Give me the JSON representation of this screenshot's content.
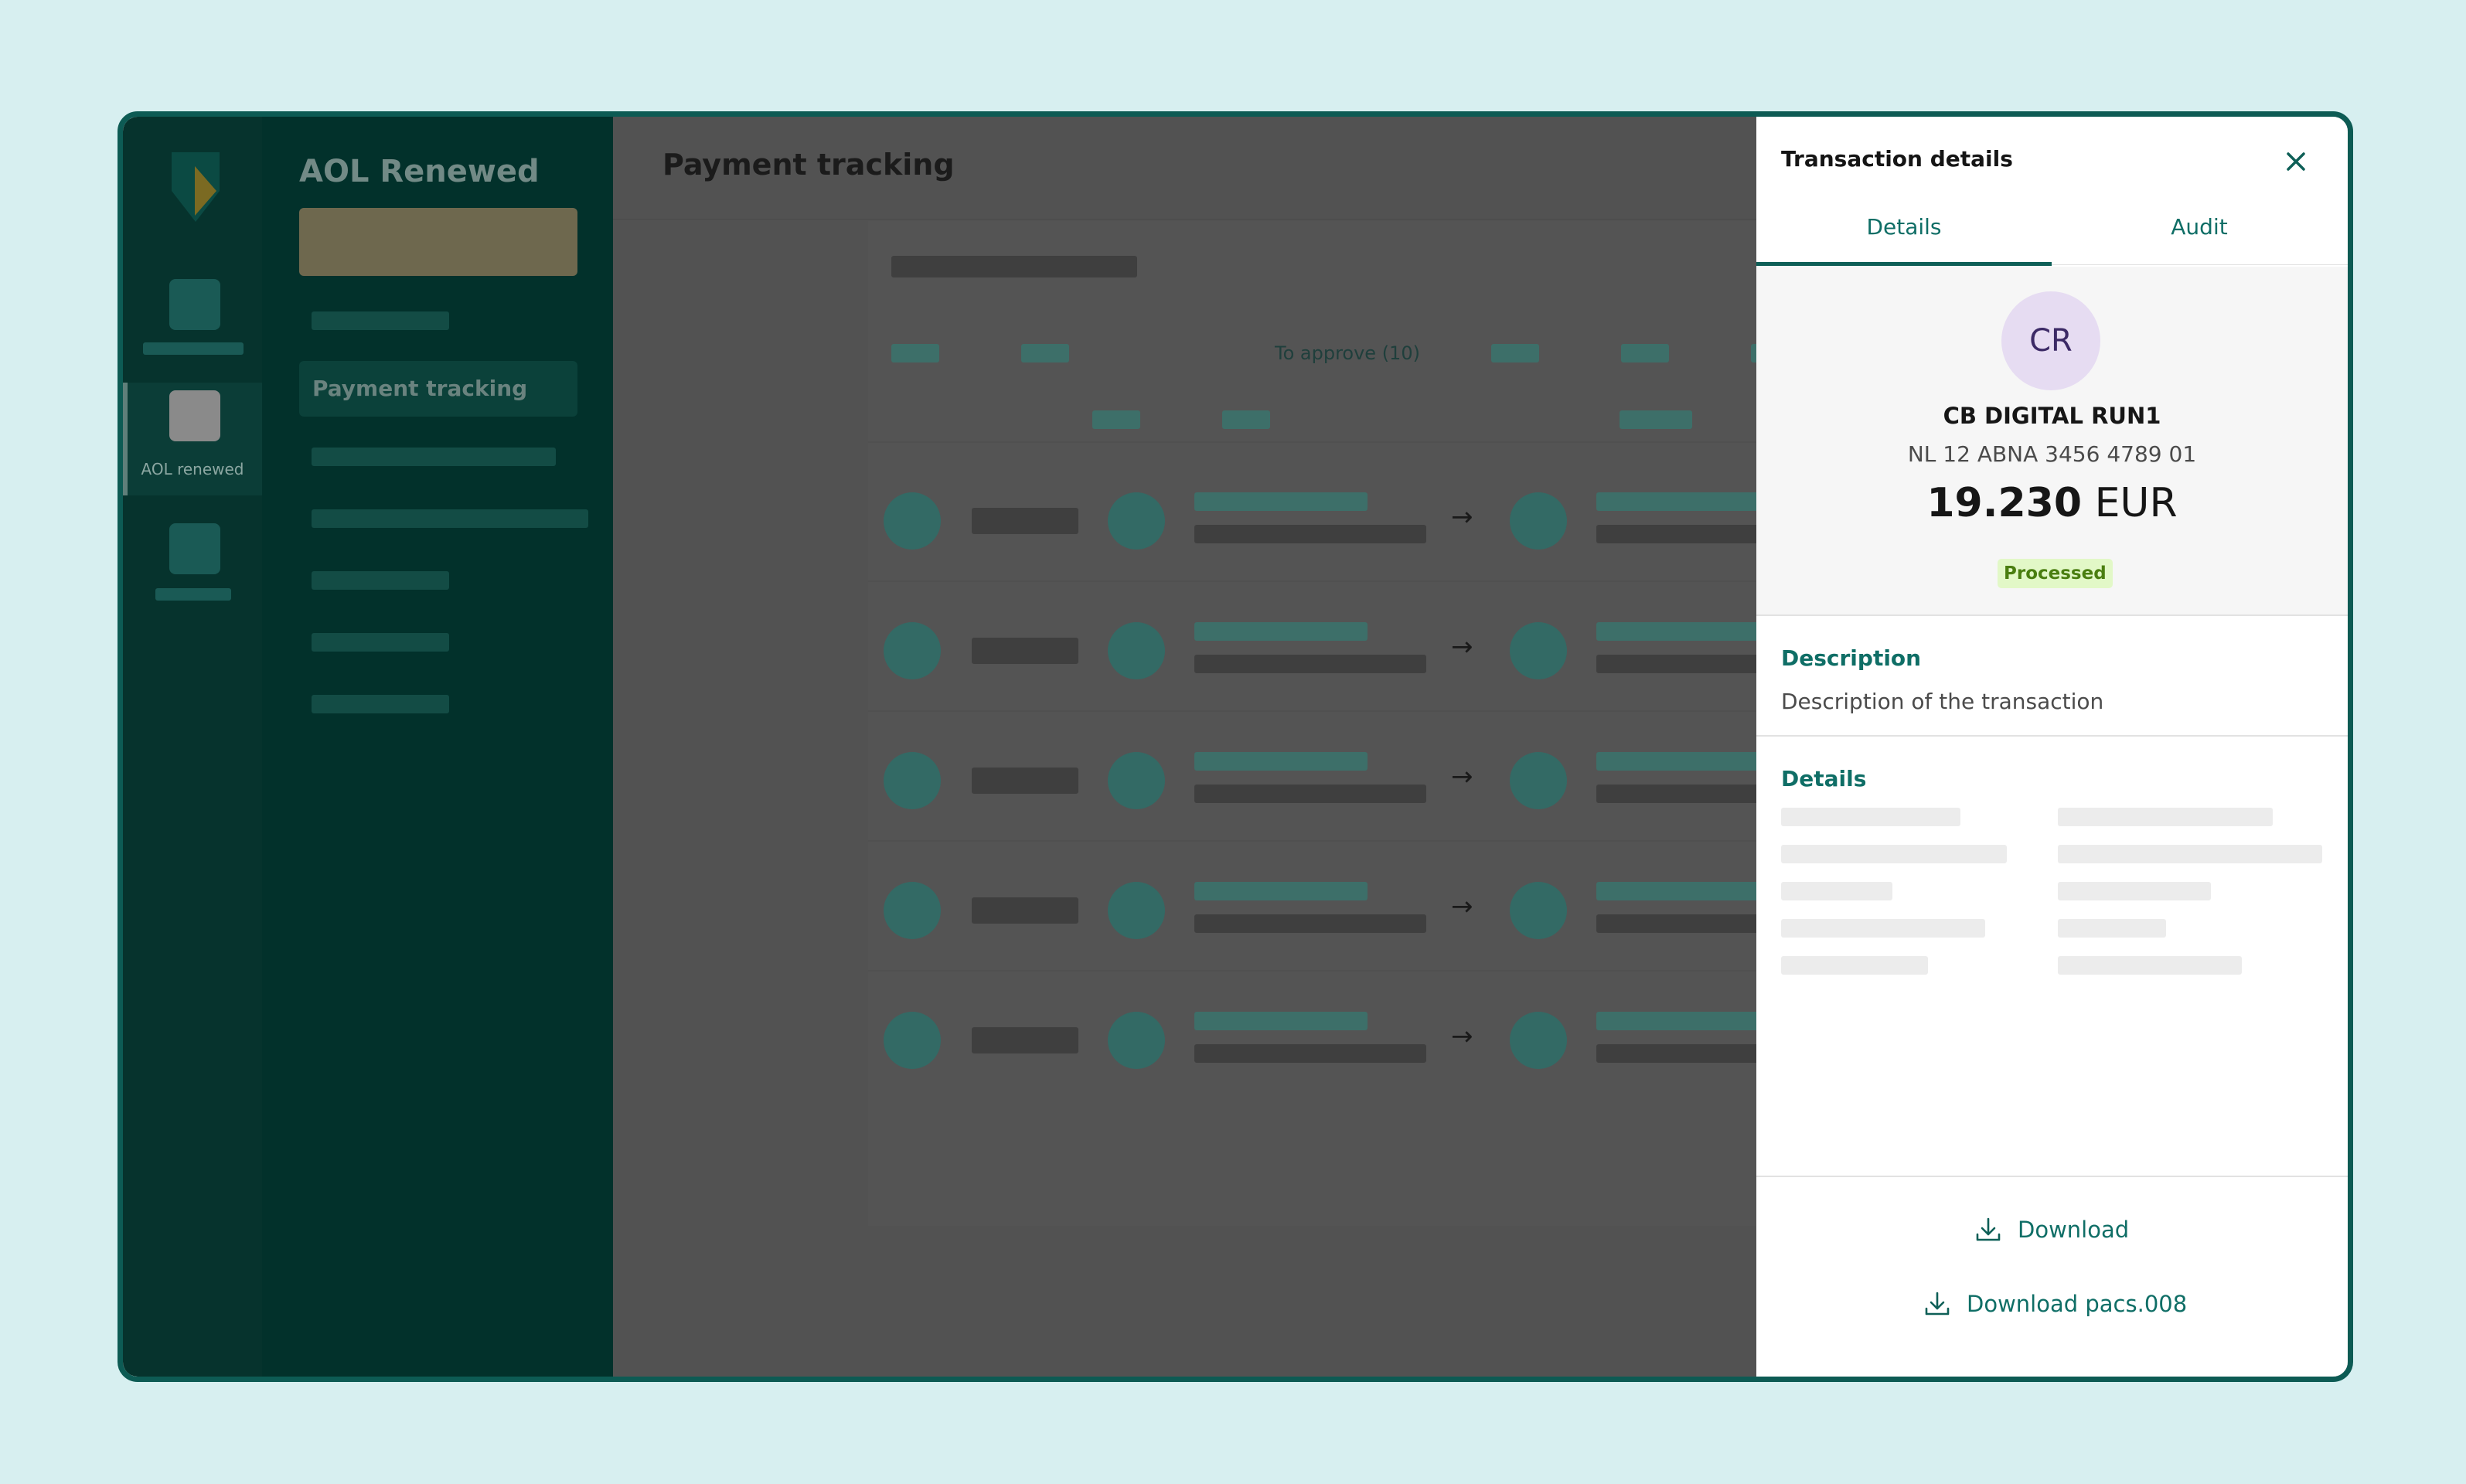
{
  "app": {
    "nav_rail": {
      "active_item_label": "AOL renewed"
    },
    "sidebar": {
      "title": "AOL Renewed",
      "active_item_label": "Payment tracking"
    }
  },
  "main": {
    "page_title": "Payment tracking",
    "tabs": {
      "active_tab_label": "To approve (10)"
    },
    "row_arrow": "→"
  },
  "panel": {
    "title": "Transaction details",
    "tabs": [
      {
        "label": "Details",
        "selected": true
      },
      {
        "label": "Audit",
        "selected": false
      }
    ],
    "counterparty": {
      "initials": "CR",
      "name": "CB DIGITAL RUN1",
      "iban": "NL 12 ABNA 3456 4789 01",
      "amount": "19.230",
      "currency": "EUR",
      "status": "Processed"
    },
    "description": {
      "heading": "Description",
      "text": "Description of the transaction"
    },
    "details": {
      "heading": "Details"
    },
    "actions": {
      "download": "Download",
      "download_pacs": "Download pacs.008"
    }
  },
  "colors": {
    "brand_teal": "#0f6e66",
    "frame_border": "#0d5b54",
    "status_processed_bg": "#e2f8c7",
    "status_processed_text": "#4a7e10",
    "avatar_bg": "#e6dcf2"
  },
  "icons": [
    "abn-amro-shield-logo",
    "close-icon",
    "download-icon",
    "arrow-right-icon"
  ]
}
